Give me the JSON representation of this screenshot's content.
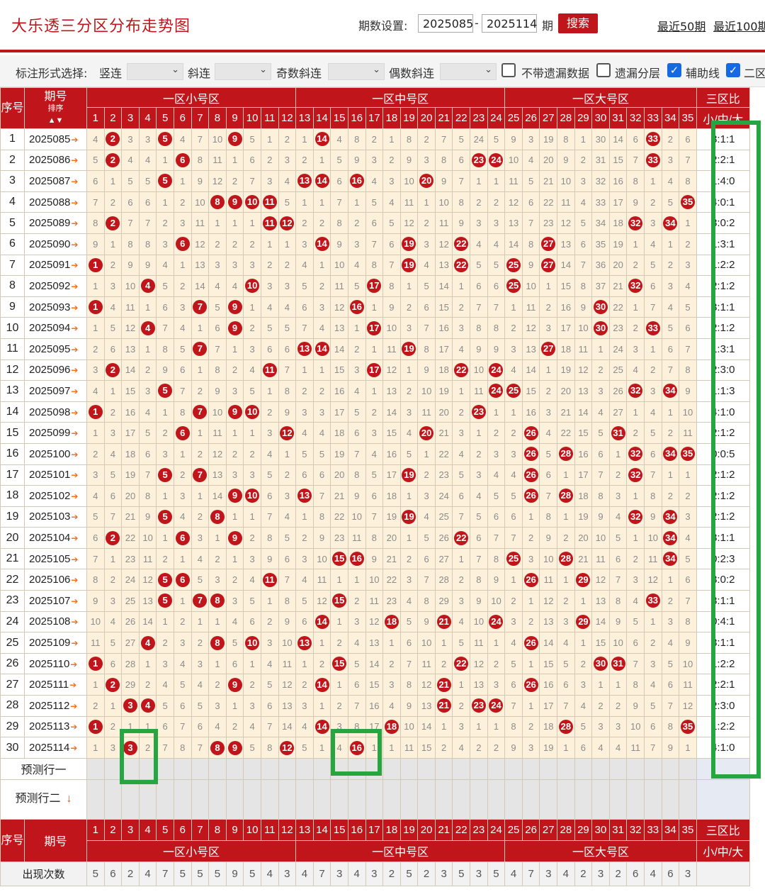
{
  "header": {
    "title": "大乐透三分区分布走势图",
    "period_label": "期数设置:",
    "from_value": "2025085",
    "dash": "-",
    "to_value": "2025114",
    "period_unit": "期",
    "search_label": "搜索",
    "link_50": "最近50期",
    "link_100": "最近100期"
  },
  "filter": {
    "mode_label": "标注形式选择:",
    "vertical_label": "竖连",
    "diagonal_label": "斜连",
    "odd_label": "奇数斜连",
    "even_label": "偶数斜连",
    "no_miss_label": "不带遗漏数据",
    "no_miss_checked": false,
    "miss_layer_label": "遗漏分层",
    "miss_layer_checked": false,
    "aux_label": "辅助线",
    "aux_checked": true,
    "zone2_label": "二区",
    "zone2_checked": true
  },
  "table": {
    "col_index_label": "序号",
    "col_issue_label": "期号",
    "sort_label": "排序",
    "zones": [
      "一区小号区",
      "一区中号区",
      "一区大号区"
    ],
    "ratio_title": "三区比",
    "ratio_sub": "小/中/大",
    "rows": [
      {
        "idx": "1",
        "issue": "2025085",
        "cells": [
          4,
          "B",
          3,
          3,
          "B",
          4,
          7,
          10,
          "B",
          5,
          1,
          2,
          1,
          "B",
          4,
          8,
          2,
          1,
          8,
          2,
          7,
          5,
          24,
          5,
          9,
          3,
          19,
          8,
          1,
          30,
          14,
          6,
          "B",
          2,
          6
        ],
        "ratio": "3:1:1"
      },
      {
        "idx": "2",
        "issue": "2025086",
        "cells": [
          5,
          "B",
          4,
          4,
          1,
          "B",
          8,
          11,
          1,
          6,
          2,
          3,
          2,
          1,
          5,
          9,
          3,
          2,
          9,
          3,
          8,
          6,
          "B",
          "B",
          10,
          4,
          20,
          9,
          2,
          31,
          15,
          7,
          "B",
          3,
          7
        ],
        "ratio": "2:2:1"
      },
      {
        "idx": "3",
        "issue": "2025087",
        "cells": [
          6,
          1,
          5,
          5,
          "B",
          1,
          9,
          12,
          2,
          7,
          3,
          4,
          "B",
          "B",
          6,
          "B",
          4,
          3,
          10,
          "B",
          9,
          7,
          1,
          1,
          11,
          5,
          21,
          10,
          3,
          32,
          16,
          8,
          1,
          4,
          8
        ],
        "ratio": "1:4:0"
      },
      {
        "idx": "4",
        "issue": "2025088",
        "cells": [
          7,
          2,
          6,
          6,
          1,
          2,
          10,
          "B",
          "B",
          "B",
          "B",
          5,
          1,
          1,
          7,
          1,
          5,
          4,
          11,
          1,
          10,
          8,
          2,
          2,
          12,
          6,
          22,
          11,
          4,
          33,
          17,
          9,
          2,
          5,
          "B"
        ],
        "ratio": "4:0:1"
      },
      {
        "idx": "5",
        "issue": "2025089",
        "cells": [
          8,
          "B",
          7,
          7,
          2,
          3,
          11,
          1,
          1,
          1,
          "B",
          "B",
          2,
          2,
          8,
          2,
          6,
          5,
          12,
          2,
          11,
          9,
          3,
          3,
          13,
          7,
          23,
          12,
          5,
          34,
          18,
          "B",
          3,
          "B",
          1
        ],
        "ratio": "3:0:2"
      },
      {
        "idx": "6",
        "issue": "2025090",
        "cells": [
          9,
          1,
          8,
          8,
          3,
          "B",
          12,
          2,
          2,
          2,
          1,
          1,
          3,
          "B",
          9,
          3,
          7,
          6,
          "B",
          3,
          12,
          "B",
          4,
          4,
          14,
          8,
          "B",
          13,
          6,
          35,
          19,
          1,
          4,
          1,
          2
        ],
        "ratio": "1:3:1"
      },
      {
        "idx": "7",
        "issue": "2025091",
        "cells": [
          "B",
          2,
          9,
          9,
          4,
          1,
          13,
          3,
          3,
          3,
          2,
          2,
          4,
          1,
          10,
          4,
          8,
          7,
          "B",
          4,
          13,
          "B",
          5,
          5,
          "B",
          9,
          "B",
          14,
          7,
          36,
          20,
          2,
          5,
          2,
          3
        ],
        "ratio": "1:2:2"
      },
      {
        "idx": "8",
        "issue": "2025092",
        "cells": [
          1,
          3,
          10,
          "B",
          5,
          2,
          14,
          4,
          4,
          "B",
          3,
          3,
          5,
          2,
          11,
          5,
          "B",
          8,
          1,
          5,
          14,
          1,
          6,
          6,
          "B",
          10,
          1,
          15,
          8,
          37,
          21,
          "B",
          6,
          3,
          4
        ],
        "ratio": "2:1:2"
      },
      {
        "idx": "9",
        "issue": "2025093",
        "cells": [
          "B",
          4,
          11,
          1,
          6,
          3,
          "B",
          5,
          "B",
          1,
          4,
          4,
          6,
          3,
          12,
          "B",
          1,
          9,
          2,
          6,
          15,
          2,
          7,
          7,
          1,
          11,
          2,
          16,
          9,
          "B",
          22,
          1,
          7,
          4,
          5
        ],
        "ratio": "3:1:1"
      },
      {
        "idx": "10",
        "issue": "2025094",
        "cells": [
          1,
          5,
          12,
          "B",
          7,
          4,
          1,
          6,
          "B",
          2,
          5,
          5,
          7,
          4,
          13,
          1,
          "B",
          10,
          3,
          7,
          16,
          3,
          8,
          8,
          2,
          12,
          3,
          17,
          10,
          "B",
          23,
          2,
          "B",
          5,
          6
        ],
        "ratio": "2:1:2"
      },
      {
        "idx": "11",
        "issue": "2025095",
        "cells": [
          2,
          6,
          13,
          1,
          8,
          5,
          "B",
          7,
          1,
          3,
          6,
          6,
          "B",
          "B",
          14,
          2,
          1,
          11,
          "B",
          8,
          17,
          4,
          9,
          9,
          3,
          13,
          "B",
          18,
          11,
          1,
          24,
          3,
          1,
          6,
          7
        ],
        "ratio": "1:3:1"
      },
      {
        "idx": "12",
        "issue": "2025096",
        "cells": [
          3,
          "B",
          14,
          2,
          9,
          6,
          1,
          8,
          2,
          4,
          "B",
          7,
          1,
          1,
          15,
          3,
          "B",
          12,
          1,
          9,
          18,
          "B",
          10,
          "B",
          4,
          14,
          1,
          19,
          12,
          2,
          25,
          4,
          2,
          7,
          8
        ],
        "ratio": "2:3:0"
      },
      {
        "idx": "13",
        "issue": "2025097",
        "cells": [
          4,
          1,
          15,
          3,
          "B",
          7,
          2,
          9,
          3,
          5,
          1,
          8,
          2,
          2,
          16,
          4,
          1,
          13,
          2,
          10,
          19,
          1,
          11,
          "B",
          "B",
          15,
          2,
          20,
          13,
          3,
          26,
          "B",
          3,
          "B",
          9
        ],
        "ratio": "1:1:3"
      },
      {
        "idx": "14",
        "issue": "2025098",
        "cells": [
          "B",
          2,
          16,
          4,
          1,
          8,
          "B",
          10,
          "B",
          "B",
          2,
          9,
          3,
          3,
          17,
          5,
          2,
          14,
          3,
          11,
          20,
          2,
          "B",
          1,
          1,
          16,
          3,
          21,
          14,
          4,
          27,
          1,
          4,
          1,
          10
        ],
        "ratio": "4:1:0"
      },
      {
        "idx": "15",
        "issue": "2025099",
        "cells": [
          1,
          3,
          17,
          5,
          2,
          "B",
          1,
          11,
          1,
          1,
          3,
          "B",
          4,
          4,
          18,
          6,
          3,
          15,
          4,
          "B",
          21,
          3,
          1,
          2,
          2,
          "B",
          4,
          22,
          15,
          5,
          "B",
          2,
          5,
          2,
          11
        ],
        "ratio": "2:1:2"
      },
      {
        "idx": "16",
        "issue": "2025100",
        "cells": [
          2,
          4,
          18,
          6,
          3,
          1,
          2,
          12,
          2,
          2,
          4,
          1,
          5,
          5,
          19,
          7,
          4,
          16,
          5,
          1,
          22,
          4,
          2,
          3,
          3,
          "B",
          5,
          "B",
          16,
          6,
          1,
          "B",
          6,
          "B",
          "B"
        ],
        "ratio": "0:0:5"
      },
      {
        "idx": "17",
        "issue": "2025101",
        "cells": [
          3,
          5,
          19,
          7,
          "B",
          2,
          "B",
          13,
          3,
          3,
          5,
          2,
          6,
          6,
          20,
          8,
          5,
          17,
          "B",
          2,
          23,
          5,
          3,
          4,
          4,
          "B",
          6,
          1,
          17,
          7,
          2,
          "B",
          7,
          1,
          1
        ],
        "ratio": "2:1:2"
      },
      {
        "idx": "18",
        "issue": "2025102",
        "cells": [
          4,
          6,
          20,
          8,
          1,
          3,
          1,
          14,
          "B",
          "B",
          6,
          3,
          "B",
          7,
          21,
          9,
          6,
          18,
          1,
          3,
          24,
          6,
          4,
          5,
          5,
          "B",
          7,
          "B",
          18,
          8,
          3,
          1,
          8,
          2,
          2
        ],
        "ratio": "2:1:2"
      },
      {
        "idx": "19",
        "issue": "2025103",
        "cells": [
          5,
          7,
          21,
          9,
          "B",
          4,
          2,
          "B",
          1,
          1,
          7,
          4,
          1,
          8,
          22,
          10,
          7,
          19,
          "B",
          4,
          25,
          7,
          5,
          6,
          6,
          1,
          8,
          1,
          19,
          9,
          4,
          "B",
          9,
          "B",
          3
        ],
        "ratio": "2:1:2"
      },
      {
        "idx": "20",
        "issue": "2025104",
        "cells": [
          6,
          "B",
          22,
          10,
          1,
          "B",
          3,
          1,
          "B",
          2,
          8,
          5,
          2,
          9,
          23,
          11,
          8,
          20,
          1,
          5,
          26,
          "B",
          6,
          7,
          7,
          2,
          9,
          2,
          20,
          10,
          5,
          1,
          10,
          "B",
          4
        ],
        "ratio": "3:1:1"
      },
      {
        "idx": "21",
        "issue": "2025105",
        "cells": [
          7,
          1,
          23,
          11,
          2,
          1,
          4,
          2,
          1,
          3,
          9,
          6,
          3,
          10,
          "B",
          "B",
          9,
          21,
          2,
          6,
          27,
          1,
          7,
          8,
          "B",
          3,
          10,
          "B",
          21,
          11,
          6,
          2,
          11,
          "B",
          5
        ],
        "ratio": "0:2:3"
      },
      {
        "idx": "22",
        "issue": "2025106",
        "cells": [
          8,
          2,
          24,
          12,
          "B",
          "B",
          5,
          3,
          2,
          4,
          "B",
          7,
          4,
          11,
          1,
          1,
          10,
          22,
          3,
          7,
          28,
          2,
          8,
          9,
          1,
          "B",
          11,
          1,
          "B",
          12,
          7,
          3,
          12,
          1,
          6
        ],
        "ratio": "3:0:2"
      },
      {
        "idx": "23",
        "issue": "2025107",
        "cells": [
          9,
          3,
          25,
          13,
          "B",
          1,
          "B",
          "B",
          3,
          5,
          1,
          8,
          5,
          12,
          "B",
          2,
          11,
          23,
          4,
          8,
          29,
          3,
          9,
          10,
          2,
          1,
          12,
          2,
          1,
          13,
          8,
          4,
          "B",
          2,
          7
        ],
        "ratio": "3:1:1"
      },
      {
        "idx": "24",
        "issue": "2025108",
        "cells": [
          10,
          4,
          26,
          14,
          1,
          2,
          1,
          1,
          4,
          6,
          2,
          9,
          6,
          "B",
          1,
          3,
          12,
          "B",
          5,
          9,
          "B",
          4,
          10,
          "B",
          3,
          2,
          13,
          3,
          "B",
          14,
          9,
          5,
          1,
          3,
          8
        ],
        "ratio": "0:4:1"
      },
      {
        "idx": "25",
        "issue": "2025109",
        "cells": [
          11,
          5,
          27,
          "B",
          2,
          3,
          2,
          "B",
          5,
          "B",
          3,
          10,
          "B",
          1,
          2,
          4,
          13,
          1,
          6,
          10,
          1,
          5,
          11,
          1,
          4,
          "B",
          14,
          4,
          1,
          15,
          10,
          6,
          2,
          4,
          9
        ],
        "ratio": "3:1:1"
      },
      {
        "idx": "26",
        "issue": "2025110",
        "cells": [
          "B",
          6,
          28,
          1,
          3,
          4,
          3,
          1,
          6,
          1,
          4,
          11,
          1,
          2,
          "B",
          5,
          14,
          2,
          7,
          11,
          2,
          "B",
          12,
          2,
          5,
          1,
          15,
          5,
          2,
          "B",
          "B",
          7,
          3,
          5,
          10
        ],
        "ratio": "1:2:2"
      },
      {
        "idx": "27",
        "issue": "2025111",
        "cells": [
          1,
          "B",
          29,
          2,
          4,
          5,
          4,
          2,
          "B",
          2,
          5,
          12,
          2,
          "B",
          1,
          6,
          15,
          3,
          8,
          12,
          "B",
          1,
          13,
          3,
          6,
          "B",
          16,
          6,
          3,
          1,
          1,
          8,
          4,
          6,
          11
        ],
        "ratio": "2:2:1"
      },
      {
        "idx": "28",
        "issue": "2025112",
        "cells": [
          2,
          1,
          "B",
          "B",
          5,
          6,
          5,
          3,
          1,
          3,
          6,
          13,
          3,
          1,
          2,
          7,
          16,
          4,
          9,
          13,
          "B",
          2,
          "B",
          "B",
          7,
          1,
          17,
          7,
          4,
          2,
          2,
          9,
          5,
          7,
          12
        ],
        "ratio": "2:3:0"
      },
      {
        "idx": "29",
        "issue": "2025113",
        "cells": [
          "B",
          2,
          1,
          1,
          6,
          7,
          6,
          4,
          2,
          4,
          7,
          14,
          4,
          "B",
          3,
          8,
          17,
          "B",
          10,
          14,
          1,
          3,
          1,
          1,
          8,
          2,
          18,
          "B",
          5,
          3,
          3,
          10,
          6,
          8,
          "B"
        ],
        "ratio": "1:2:2"
      },
      {
        "idx": "30",
        "issue": "2025114",
        "cells": [
          1,
          3,
          "B",
          2,
          7,
          8,
          7,
          "B",
          "B",
          5,
          8,
          "B",
          5,
          1,
          4,
          "B",
          1,
          1,
          11,
          15,
          2,
          4,
          2,
          2,
          9,
          3,
          19,
          1,
          6,
          4,
          4,
          11,
          7,
          9,
          1
        ],
        "ratio": "4:1:0"
      }
    ],
    "predict_row1_label": "预测行一",
    "predict_row2_label": "预测行二",
    "count_label": "出现次数",
    "counts": [
      5,
      6,
      2,
      4,
      7,
      5,
      5,
      5,
      9,
      5,
      4,
      3,
      4,
      7,
      3,
      4,
      3,
      2,
      5,
      2,
      3,
      5,
      3,
      5,
      4,
      7,
      3,
      4,
      2,
      3,
      2,
      6,
      4,
      6,
      3
    ],
    "colors": {
      "brand_red": "#c0161b",
      "cell_bg": "#fdf1dc",
      "annotation_green": "#26a641",
      "arrow_orange": "#f37021"
    }
  }
}
